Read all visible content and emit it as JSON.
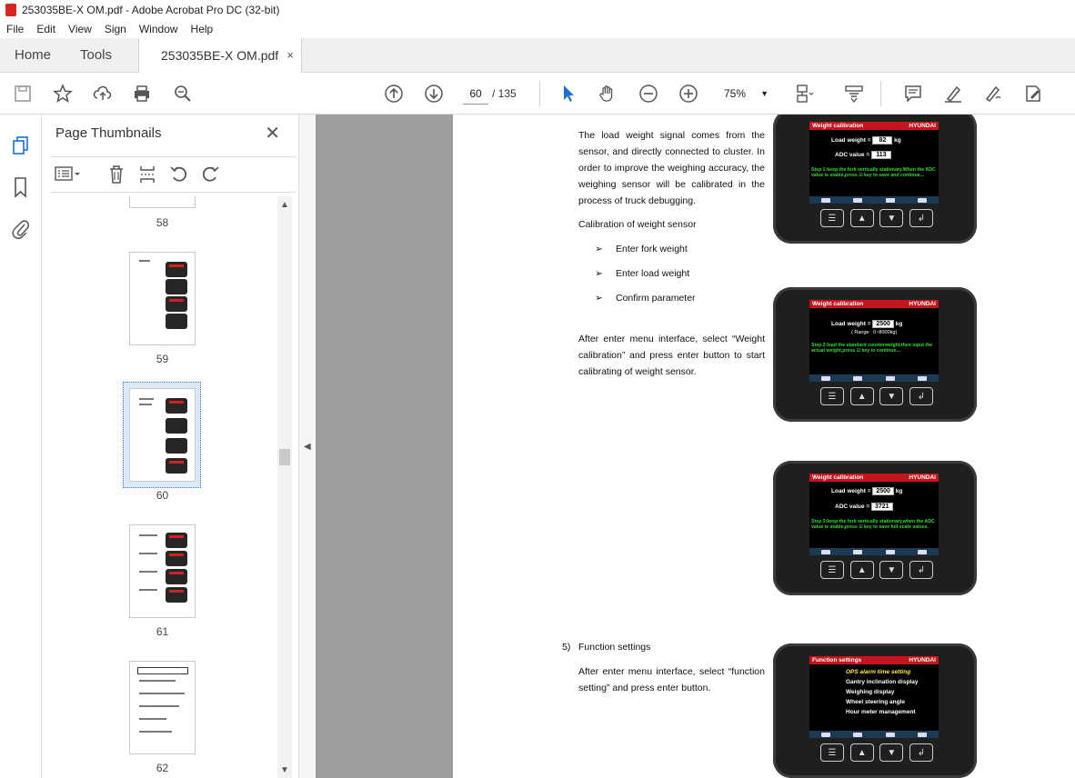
{
  "window": {
    "title": "253035BE-X OM.pdf - Adobe Acrobat Pro DC (32-bit)"
  },
  "menu": [
    "File",
    "Edit",
    "View",
    "Sign",
    "Window",
    "Help"
  ],
  "tabs": {
    "home": "Home",
    "tools": "Tools",
    "doc": "253035BE-X OM.pdf",
    "close": "×"
  },
  "toolbar": {
    "page_current": "60",
    "page_total": "/ 135",
    "zoom": "75%"
  },
  "panel": {
    "title": "Page Thumbnails",
    "close": "✕",
    "pages": [
      "58",
      "59",
      "60",
      "61",
      "62"
    ],
    "selected": "60"
  },
  "document": {
    "intro": "The load weight signal comes from the sensor, and directly connected to cluster. In order to improve the weighing accuracy, the weighing sensor will be calibrated in the process of truck debugging.",
    "calib_heading": "Calibration of weight sensor",
    "bullets": [
      "Enter fork weight",
      "Enter load weight",
      "Confirm parameter"
    ],
    "after_menu": "After enter menu interface, select “Weight calibration” and press enter button to start calibrating of weight sensor.",
    "section5_num": "5)",
    "section5_title": "Function settings",
    "func_text": "After enter menu interface, select “function setting” and press enter button."
  },
  "devices": [
    {
      "title": "Weight calibration",
      "brand": "HYUNDAI",
      "row1_label": "Load weight =",
      "row1_value": "82",
      "row1_unit": "kg",
      "row2_label": "ADC value =",
      "row2_value": "113",
      "hint": "Step 1:keep the fork vertically stationary.When the ADC value is stable,press ⊡ key to save and continue..."
    },
    {
      "title": "Weight calibration",
      "brand": "HYUNDAI",
      "row1_label": "Load weight =",
      "row1_value": "2500",
      "row1_unit": "kg",
      "range": "( Range : 0~8000kg)",
      "hint": "Step 2:load the standard counterweight,then input the actual weight,press ⊡ key to continue..."
    },
    {
      "title": "Weight calibration",
      "brand": "HYUNDAI",
      "row1_label": "Load weight =",
      "row1_value": "2500",
      "row1_unit": "kg",
      "row2_label": "ADC value =",
      "row2_value": "3721",
      "hint": "Step 3:keep the fork vertically stationary,when the ADC value is stable,press ⊡ key to save full-scale values."
    },
    {
      "title": "Function settings",
      "brand": "HYUNDAI",
      "menu": [
        "OPS alarm time setting",
        "Gantry inclination display",
        "Weighing display",
        "Wheel steering angle",
        "Hour meter management"
      ]
    }
  ],
  "colors": {
    "accent_red": "#c3151b",
    "hint_green": "#33dd33",
    "select_blue": "#3d7fc4"
  }
}
